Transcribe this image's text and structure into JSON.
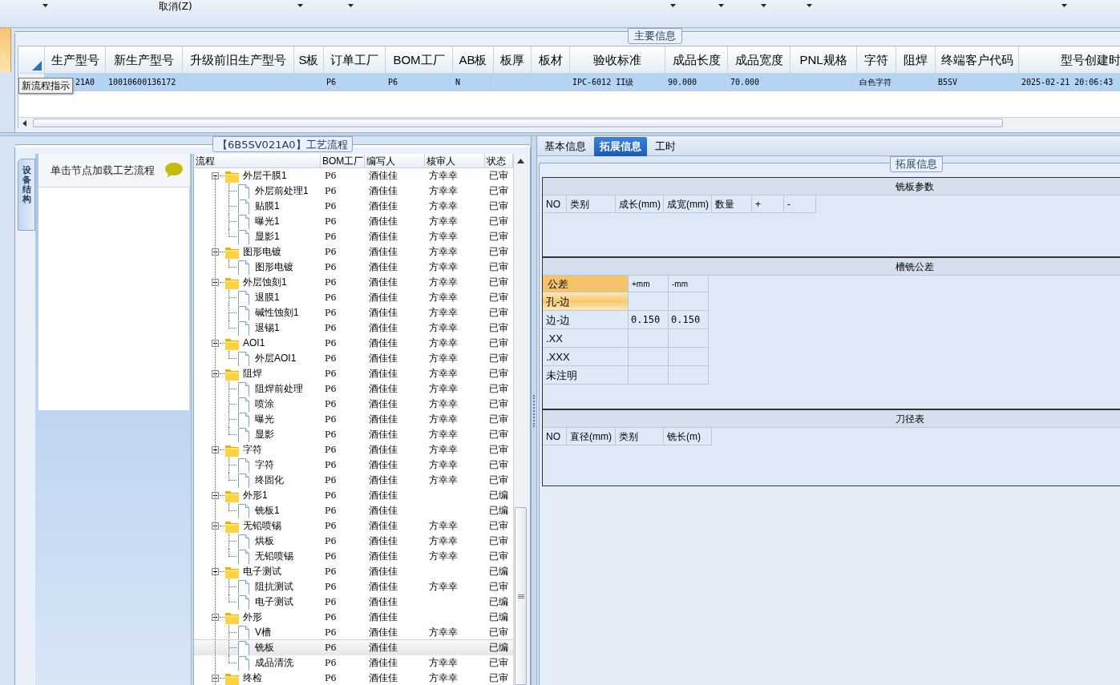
{
  "toolbar": [
    {
      "kind": "dropdown"
    },
    {
      "kind": "button",
      "label": "取消(Z)"
    },
    {
      "kind": "dropdown"
    },
    {
      "kind": "dropdown"
    },
    {
      "kind": "dropdown"
    },
    {
      "kind": "dropdown"
    },
    {
      "kind": "dropdown"
    },
    {
      "kind": "dropdown"
    },
    {
      "kind": "dropdown"
    }
  ],
  "main_info": {
    "title": "主要信息",
    "columns": [
      "生产型号",
      "新生产型号",
      "升级前旧生产型号",
      "S板",
      "订单工厂",
      "BOM工厂",
      "AB板",
      "板厚",
      "板材",
      "验收标准",
      "成品长度",
      "成品宽度",
      "PNL规格",
      "字符",
      "阻焊",
      "终端客户代码",
      "型号创建时"
    ],
    "rows": [
      {
        "selected": true,
        "cells": [
          "21A0",
          "10010600136172",
          null,
          null,
          "P6",
          "P6",
          "N",
          null,
          null,
          "IPC-6012 II级",
          "90.000",
          "70.000",
          null,
          "白色字符",
          null,
          "B5SV",
          "2025-02-21 20:06:43"
        ]
      }
    ],
    "tooltip": "新流程指示"
  },
  "process": {
    "title": "【6B5SV021A0】工艺流程",
    "side_tab": "设备结构",
    "hint": "单击节点加载工艺流程",
    "columns": [
      "流程",
      "BOM工厂",
      "编写人",
      "核审人",
      "状态"
    ],
    "tree": [
      {
        "label": "外层干膜1",
        "bom": "P6",
        "writer": "酒佳佳",
        "reviewer": "方幸幸",
        "status": "已审",
        "expanded": true,
        "selected": false,
        "children": [
          {
            "label": "外层前处理1",
            "bom": "P6",
            "writer": "酒佳佳",
            "reviewer": "方幸幸",
            "status": "已审",
            "selected": false
          },
          {
            "label": "贴膜1",
            "bom": "P6",
            "writer": "酒佳佳",
            "reviewer": "方幸幸",
            "status": "已审",
            "selected": false
          },
          {
            "label": "曝光1",
            "bom": "P6",
            "writer": "酒佳佳",
            "reviewer": "方幸幸",
            "status": "已审",
            "selected": false
          },
          {
            "label": "显影1",
            "bom": "P6",
            "writer": "酒佳佳",
            "reviewer": "方幸幸",
            "status": "已审",
            "selected": false
          }
        ]
      },
      {
        "label": "图形电镀",
        "bom": "P6",
        "writer": "酒佳佳",
        "reviewer": "方幸幸",
        "status": "已审",
        "expanded": true,
        "selected": false,
        "children": [
          {
            "label": "图形电镀",
            "bom": "P6",
            "writer": "酒佳佳",
            "reviewer": "方幸幸",
            "status": "已审",
            "selected": false
          }
        ]
      },
      {
        "label": "外层蚀刻1",
        "bom": "P6",
        "writer": "酒佳佳",
        "reviewer": "方幸幸",
        "status": "已审",
        "expanded": true,
        "selected": false,
        "children": [
          {
            "label": "退膜1",
            "bom": "P6",
            "writer": "酒佳佳",
            "reviewer": "方幸幸",
            "status": "已审",
            "selected": false
          },
          {
            "label": "碱性蚀刻1",
            "bom": "P6",
            "writer": "酒佳佳",
            "reviewer": "方幸幸",
            "status": "已审",
            "selected": false
          },
          {
            "label": "退锡1",
            "bom": "P6",
            "writer": "酒佳佳",
            "reviewer": "方幸幸",
            "status": "已审",
            "selected": false
          }
        ]
      },
      {
        "label": "AOI1",
        "bom": "P6",
        "writer": "酒佳佳",
        "reviewer": "方幸幸",
        "status": "已审",
        "expanded": true,
        "selected": false,
        "children": [
          {
            "label": "外层AOI1",
            "bom": "P6",
            "writer": "酒佳佳",
            "reviewer": "方幸幸",
            "status": "已审",
            "selected": false
          }
        ]
      },
      {
        "label": "阻焊",
        "bom": "P6",
        "writer": "酒佳佳",
        "reviewer": "方幸幸",
        "status": "已审",
        "expanded": true,
        "selected": false,
        "children": [
          {
            "label": "阻焊前处理",
            "bom": "P6",
            "writer": "酒佳佳",
            "reviewer": "方幸幸",
            "status": "已审",
            "selected": false
          },
          {
            "label": "喷涂",
            "bom": "P6",
            "writer": "酒佳佳",
            "reviewer": "方幸幸",
            "status": "已审",
            "selected": false
          },
          {
            "label": "曝光",
            "bom": "P6",
            "writer": "酒佳佳",
            "reviewer": "方幸幸",
            "status": "已审",
            "selected": false
          },
          {
            "label": "显影",
            "bom": "P6",
            "writer": "酒佳佳",
            "reviewer": "方幸幸",
            "status": "已审",
            "selected": false
          }
        ]
      },
      {
        "label": "字符",
        "bom": "P6",
        "writer": "酒佳佳",
        "reviewer": "方幸幸",
        "status": "已审",
        "expanded": true,
        "selected": false,
        "children": [
          {
            "label": "字符",
            "bom": "P6",
            "writer": "酒佳佳",
            "reviewer": "方幸幸",
            "status": "已审",
            "selected": false
          },
          {
            "label": "终固化",
            "bom": "P6",
            "writer": "酒佳佳",
            "reviewer": "方幸幸",
            "status": "已审",
            "selected": false
          }
        ]
      },
      {
        "label": "外形1",
        "bom": "P6",
        "writer": "酒佳佳",
        "status": "已编",
        "expanded": true,
        "selected": false,
        "children": [
          {
            "label": "铣板1",
            "bom": "P6",
            "writer": "酒佳佳",
            "status": "已编",
            "selected": false
          }
        ]
      },
      {
        "label": "无铅喷锡",
        "bom": "P6",
        "writer": "酒佳佳",
        "reviewer": "方幸幸",
        "status": "已审",
        "expanded": true,
        "selected": false,
        "children": [
          {
            "label": "烘板",
            "bom": "P6",
            "writer": "酒佳佳",
            "reviewer": "方幸幸",
            "status": "已审",
            "selected": false
          },
          {
            "label": "无铅喷锡",
            "bom": "P6",
            "writer": "酒佳佳",
            "reviewer": "方幸幸",
            "status": "已审",
            "selected": false
          }
        ]
      },
      {
        "label": "电子测试",
        "bom": "P6",
        "writer": "酒佳佳",
        "status": "已编",
        "expanded": true,
        "selected": false,
        "children": [
          {
            "label": "阻抗测试",
            "bom": "P6",
            "writer": "酒佳佳",
            "reviewer": "方幸幸",
            "status": "已审",
            "selected": false
          },
          {
            "label": "电子测试",
            "bom": "P6",
            "writer": "酒佳佳",
            "status": "已编",
            "selected": false
          }
        ]
      },
      {
        "label": "外形",
        "bom": "P6",
        "writer": "酒佳佳",
        "status": "已编",
        "expanded": true,
        "selected": false,
        "children": [
          {
            "label": "V槽",
            "bom": "P6",
            "writer": "酒佳佳",
            "reviewer": "方幸幸",
            "status": "已审",
            "selected": false
          },
          {
            "label": "铣板",
            "bom": "P6",
            "writer": "酒佳佳",
            "status": "已编",
            "selected": true
          },
          {
            "label": "成品清洗",
            "bom": "P6",
            "writer": "酒佳佳",
            "reviewer": "方幸幸",
            "status": "已审",
            "selected": false
          }
        ]
      },
      {
        "label": "终检",
        "bom": "P6",
        "writer": "酒佳佳",
        "reviewer": "方幸幸",
        "status": "已审",
        "expanded": true,
        "selected": false
      }
    ]
  },
  "detail": {
    "tabs": [
      {
        "label": "基本信息",
        "selected": false
      },
      {
        "label": "拓展信息",
        "selected": true
      },
      {
        "label": "工时",
        "selected": false
      }
    ],
    "group_title": "拓展信息",
    "sections": [
      {
        "kind": "grid",
        "title": "铣板参数",
        "columns": [
          "NO",
          "类别",
          "成长(mm)",
          "成宽(mm)",
          "数量",
          "+",
          "-"
        ]
      },
      {
        "kind": "tolerance",
        "title": "槽铣公差",
        "columns": [
          "公差",
          "+mm",
          "-mm"
        ],
        "rows": [
          {
            "label": "孔-边",
            "selected": true
          },
          {
            "label": "边-边",
            "plus": "0.150",
            "minus": "0.150",
            "selected": false
          },
          {
            "label": ".XX",
            "selected": false
          },
          {
            "label": ".XXX",
            "selected": false
          },
          {
            "label": "未注明",
            "selected": false
          }
        ]
      },
      {
        "kind": "grid",
        "title": "刀径表",
        "columns": [
          "NO",
          "直径(mm)",
          "类别",
          "铣长(m)"
        ]
      }
    ]
  }
}
